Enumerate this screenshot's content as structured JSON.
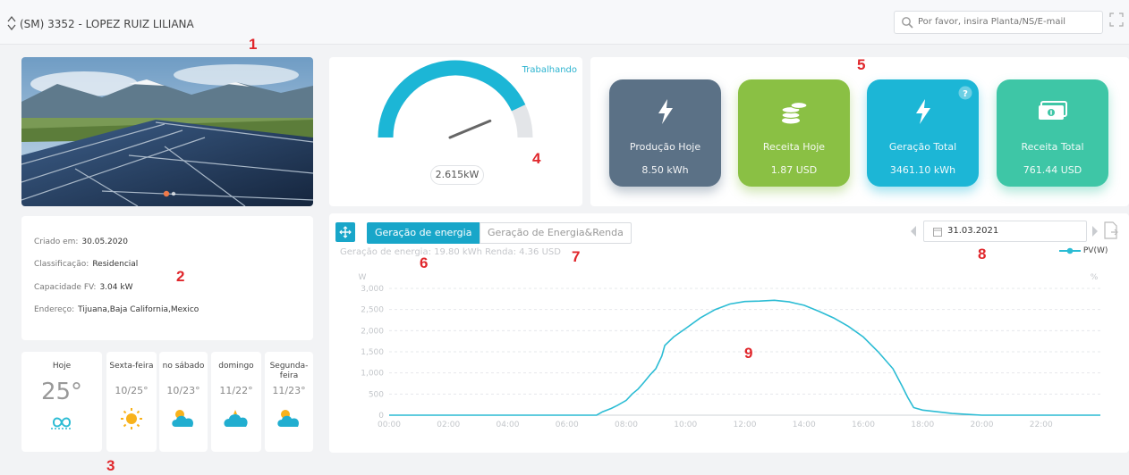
{
  "header": {
    "plant_title": "(SM) 3352 - LOPEZ RUIZ LILIANA",
    "search_placeholder": "Por favor, insira Planta/NS/E-mail"
  },
  "markers": [
    "1",
    "2",
    "3",
    "4",
    "5",
    "6",
    "7",
    "8",
    "9"
  ],
  "info": {
    "created_label": "Criado em:",
    "created_value": "30.05.2020",
    "class_label": "Classificação:",
    "class_value": "Residencial",
    "capacity_label": "Capacidade FV:",
    "capacity_value": "3.04 kW",
    "address_label": "Endereço:",
    "address_value": "Tijuana,Baja California,Mexico"
  },
  "weather": {
    "today": {
      "label": "Hoje",
      "temp": "25°",
      "icon": "wind-icon"
    },
    "days": [
      {
        "label": "Sexta-feira",
        "temp": "10/25°",
        "icon": "sun-icon"
      },
      {
        "label": "no sábado",
        "temp": "10/23°",
        "icon": "partly-cloudy-icon"
      },
      {
        "label": "domingo",
        "temp": "11/22°",
        "icon": "cloudy-icon"
      },
      {
        "label": "Segunda-feira",
        "temp": "11/23°",
        "icon": "partly-cloudy-icon"
      }
    ]
  },
  "gauge": {
    "status": "Trabalhando",
    "power": "2.615kW",
    "level_fraction": 0.86
  },
  "kpis": [
    {
      "label": "Produção Hoje",
      "value": "8.50 kWh",
      "color": "#5b7186",
      "icon": "lightning-icon"
    },
    {
      "label": "Receita Hoje",
      "value": "1.87 USD",
      "color": "#8ac044",
      "icon": "coins-icon"
    },
    {
      "label": "Geração Total",
      "value": "3461.10 kWh",
      "color": "#1cb6d6",
      "icon": "lightning-icon"
    },
    {
      "label": "Receita Total",
      "value": "761.44 USD",
      "color": "#3ec6a6",
      "icon": "cash-icon"
    }
  ],
  "chart_panel": {
    "tab_energy": "Geração de energia",
    "tab_energy_revenue": "Geração de Energia&Renda",
    "summary": "Geração de energia: 19.80 kWh    Renda: 4.36 USD",
    "date": "31.03.2021",
    "legend": "PV(W)",
    "left_unit": "W",
    "right_unit": "%"
  },
  "colors": {
    "accent": "#18a6c9",
    "line": "#2bbcd4",
    "marker": "#e0262b"
  },
  "chart_data": {
    "type": "line",
    "ylabel": "W",
    "ylim": [
      0,
      3000
    ],
    "yticks": [
      "0",
      "500",
      "1,000",
      "1,500",
      "2,000",
      "2,500",
      "3,000"
    ],
    "xticks": [
      "00:00",
      "02:00",
      "04:00",
      "06:00",
      "08:00",
      "10:00",
      "12:00",
      "14:00",
      "16:00",
      "18:00",
      "20:00",
      "22:00"
    ],
    "series": [
      {
        "name": "PV(W)",
        "x": [
          0,
          7.0,
          7.2,
          7.5,
          7.7,
          8.0,
          8.2,
          8.4,
          8.6,
          8.8,
          9.0,
          9.2,
          9.3,
          9.6,
          10.0,
          10.5,
          11.0,
          11.5,
          12.0,
          12.5,
          13.0,
          13.5,
          14.0,
          14.5,
          15.0,
          15.5,
          16.0,
          16.5,
          17.0,
          17.3,
          17.5,
          17.7,
          18.0,
          18.5,
          19.0,
          19.5,
          20.0,
          20.5,
          24.0
        ],
        "y": [
          0,
          0,
          80,
          160,
          230,
          350,
          500,
          620,
          780,
          950,
          1100,
          1400,
          1650,
          1850,
          2050,
          2300,
          2500,
          2630,
          2690,
          2700,
          2720,
          2680,
          2600,
          2460,
          2300,
          2100,
          1850,
          1500,
          1100,
          700,
          420,
          180,
          120,
          80,
          40,
          20,
          0,
          0,
          0
        ]
      }
    ]
  }
}
